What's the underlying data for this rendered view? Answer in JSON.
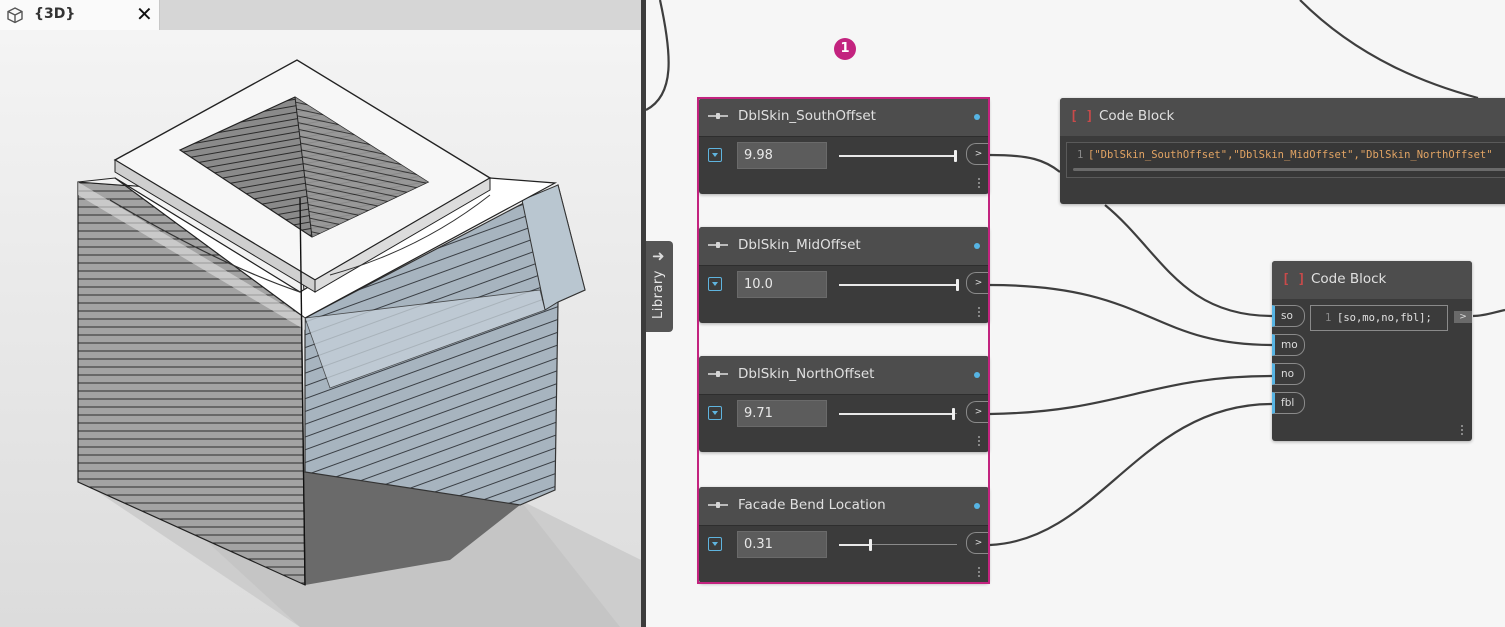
{
  "view3d": {
    "tab_title": "{3D}",
    "close_glyph": "✕"
  },
  "library": {
    "label": "Library",
    "arrow": "➜"
  },
  "annotation": {
    "badge": "1",
    "color": "#c3237f"
  },
  "sliders": [
    {
      "title": "DblSkin_SouthOffset",
      "value": "9.98",
      "fraction": 0.99
    },
    {
      "title": "DblSkin_MidOffset",
      "value": "10.0",
      "fraction": 1.0
    },
    {
      "title": "DblSkin_NorthOffset",
      "value": "9.71",
      "fraction": 0.97
    },
    {
      "title": "Facade Bend Location",
      "value": "0.31",
      "fraction": 0.27
    }
  ],
  "code_block_top": {
    "title": "Code Block",
    "line_number": "1",
    "code": "[\"DblSkin_SouthOffset\",\"DblSkin_MidOffset\",\"DblSkin_NorthOffset\"",
    "icon": "[ ]"
  },
  "code_block_main": {
    "title": "Code Block",
    "line_number": "1",
    "code": "[so,mo,no,fbl];",
    "icon": "[ ]",
    "inputs": [
      "so",
      "mo",
      "no",
      "fbl"
    ]
  },
  "port_glyph": ">",
  "colors": {
    "accent_blue": "#56b4e4",
    "node_body": "#3b3b3b",
    "node_header": "#4d4d4d",
    "string_orange": "#e2a464"
  }
}
